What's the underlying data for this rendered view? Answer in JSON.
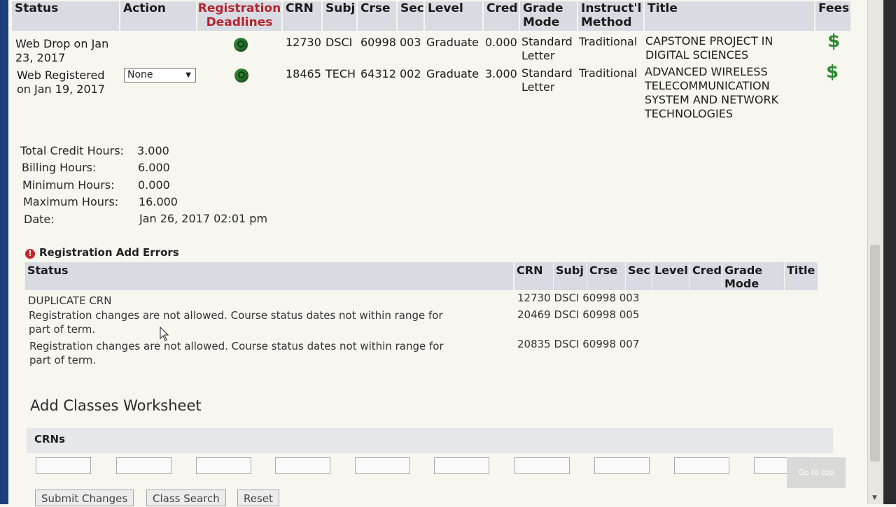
{
  "table": {
    "headers": {
      "status": "Status",
      "action": "Action",
      "reg_deadlines_1": "Registration",
      "reg_deadlines_2": "Deadlines",
      "crn": "CRN",
      "subj": "Subj",
      "crse": "Crse",
      "sec": "Sec",
      "level": "Level",
      "cred": "Cred",
      "grade_mode_1": "Grade",
      "grade_mode_2": "Mode",
      "instr_method_1": "Instruct'l",
      "instr_method_2": "Method",
      "title": "Title",
      "fees": "Fees"
    },
    "rows": [
      {
        "status_1": "Web Drop on Jan",
        "status_2": "23, 2017",
        "action": "",
        "crn": "12730",
        "subj": "DSCI",
        "crse": "60998",
        "sec": "003",
        "level": "Graduate",
        "cred": "0.000",
        "grade_mode_1": "Standard",
        "grade_mode_2": "Letter",
        "instr_method": "Traditional",
        "title_lines": [
          "CAPSTONE PROJECT IN",
          "DIGITAL SCIENCES"
        ],
        "fees_icon": "$"
      },
      {
        "status_1": "Web Registered",
        "status_2": "on Jan 19, 2017",
        "action": "None",
        "crn": "18465",
        "subj": "TECH",
        "crse": "64312",
        "sec": "002",
        "level": "Graduate",
        "cred": "3.000",
        "grade_mode_1": "Standard",
        "grade_mode_2": "Letter",
        "instr_method": "Traditional",
        "title_lines": [
          "ADVANCED WIRELESS",
          "TELECOMMUNICATION",
          "SYSTEM AND NETWORK",
          "TECHNOLOGIES"
        ],
        "fees_icon": "$"
      }
    ]
  },
  "summary": {
    "total_credit_label": "Total Credit Hours:",
    "total_credit_value": "3.000",
    "billing_label": "Billing Hours:",
    "billing_value": "6.000",
    "min_label": "Minimum Hours:",
    "min_value": "0.000",
    "max_label": "Maximum Hours:",
    "max_value": "16.000",
    "date_label": "Date:",
    "date_value": "Jan 26, 2017 02:01 pm"
  },
  "errors": {
    "title": "Registration Add Errors",
    "headers": {
      "status": "Status",
      "crn": "CRN",
      "subj": "Subj",
      "crse": "Crse",
      "sec": "Sec",
      "level": "Level",
      "cred": "Cred",
      "grade_mode_1": "Grade",
      "grade_mode_2": "Mode",
      "title": "Title"
    },
    "rows": [
      {
        "status_1": "DUPLICATE CRN",
        "status_2": "",
        "crn": "12730",
        "subj": "DSCI",
        "crse": "60998",
        "sec": "003"
      },
      {
        "status_1": "Registration changes are not allowed. Course status dates not within range for",
        "status_2": "part of term.",
        "crn": "20469",
        "subj": "DSCI",
        "crse": "60998",
        "sec": "005"
      },
      {
        "status_1": "Registration changes are not allowed. Course status dates not within range for",
        "status_2": "part of term.",
        "crn": "20835",
        "subj": "DSCI",
        "crse": "60998",
        "sec": "007"
      }
    ]
  },
  "worksheet": {
    "title": "Add Classes Worksheet",
    "crns_label": "CRNs"
  },
  "buttons": {
    "submit": "Submit Changes",
    "class_search": "Class Search",
    "reset": "Reset",
    "goto_top": "Go to top"
  },
  "colors": {
    "header_bg": "#d8dbe2",
    "deadline_red": "#b3252d",
    "fee_green": "#2f8a33"
  },
  "icons": {
    "deadline": "clock-globe-icon",
    "fees": "dollar-icon",
    "error": "error-icon"
  }
}
